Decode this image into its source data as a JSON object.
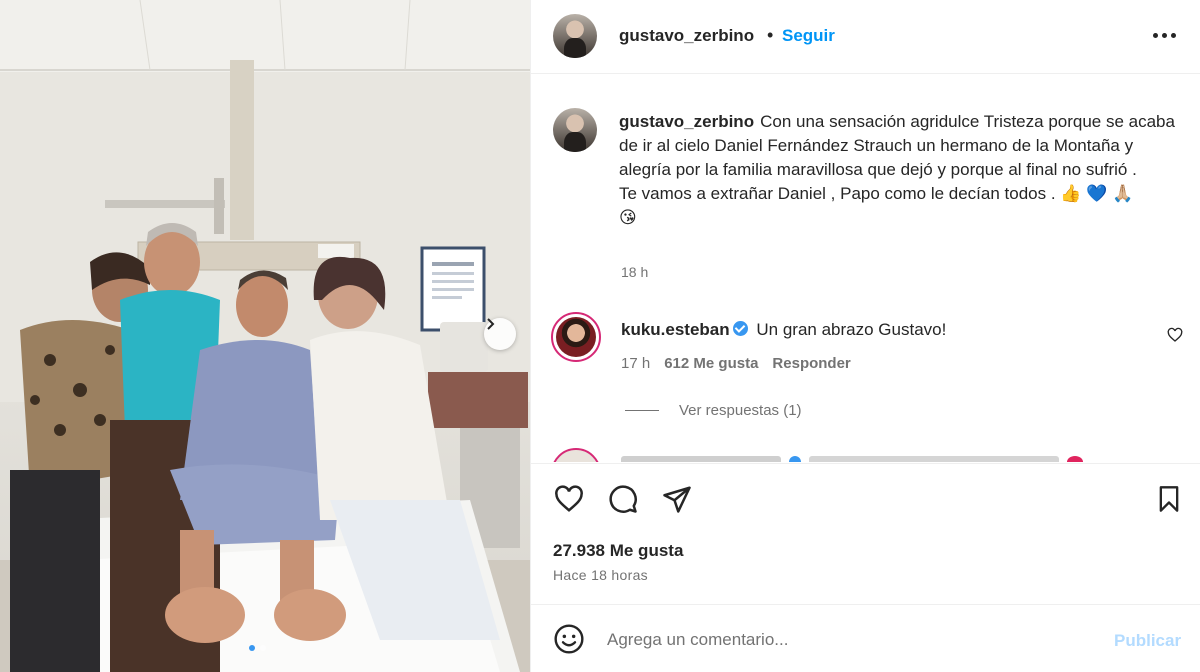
{
  "post": {
    "author": "gustavo_zerbino",
    "separator": "•",
    "follow_label": "Seguir",
    "more_icon": "more-horizontal-icon"
  },
  "caption": {
    "username": "gustavo_zerbino",
    "line1": "Con una sensación agridulce Tristeza porque se acaba de ir al cielo Daniel Fernández Strauch un hermano de la Montaña y alegría por la familia maravillosa que dejó y porque al final no sufrió .",
    "line2": "Te vamos a extrañar Daniel , Papo como le decían todos . 👍 💙 🙏🏼",
    "line3": "😘",
    "time": "18 h"
  },
  "comment": {
    "username": "kuku.esteban",
    "text": "Un gran abrazo Gustavo!",
    "time": "17 h",
    "likes": "612 Me gusta",
    "reply_label": "Responder",
    "view_replies": "Ver respuestas (1)"
  },
  "actions": {
    "likes": "27.938 Me gusta",
    "time": "Hace 18 horas"
  },
  "composer": {
    "placeholder": "Agrega un comentario...",
    "publish_label": "Publicar"
  },
  "carousel": {
    "slide_count": 2,
    "active_slide": 1
  },
  "colors": {
    "accent": "#0095f6",
    "verified": "#3897f0",
    "publish_disabled": "#b3dbff",
    "secondary_text": "#737373"
  }
}
